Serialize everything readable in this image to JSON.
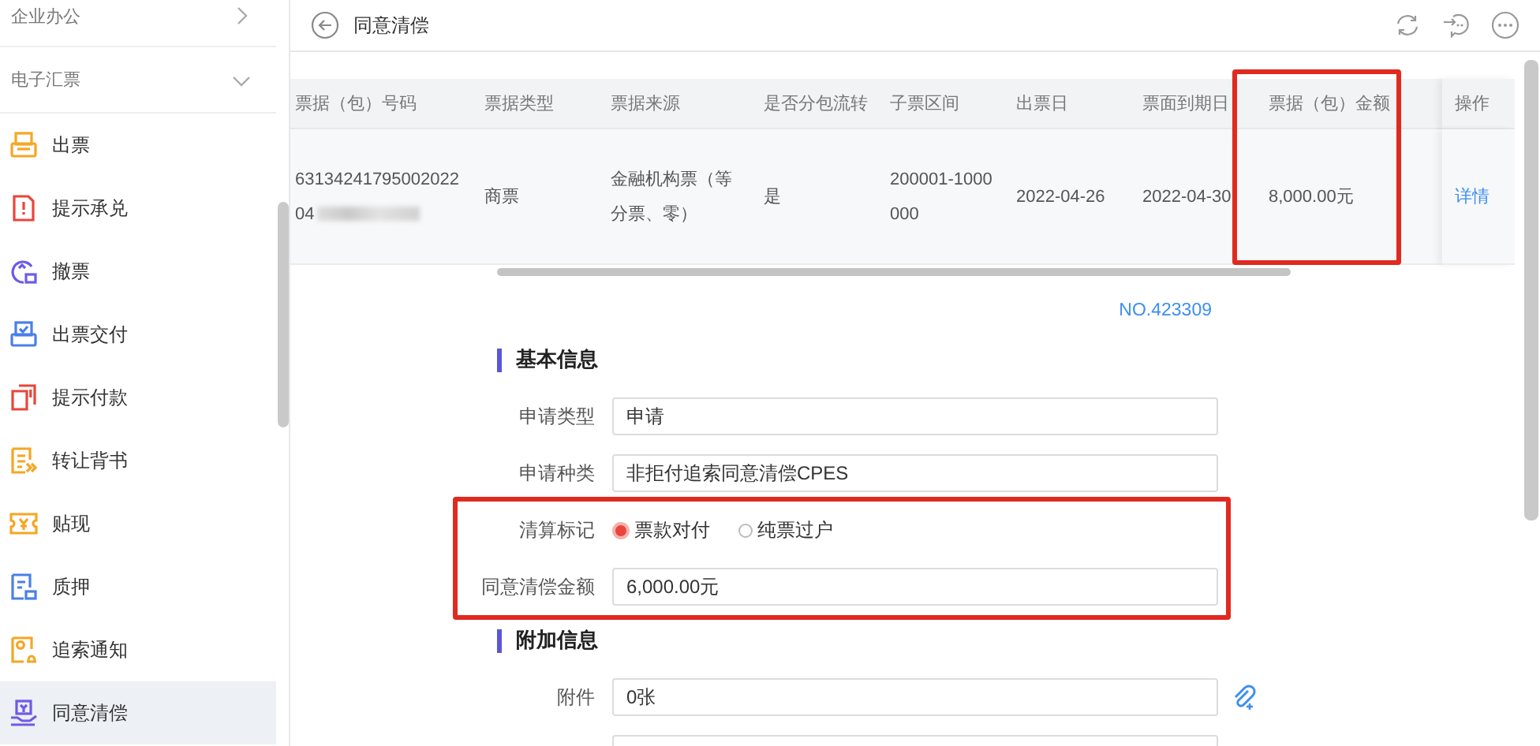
{
  "sidebar": {
    "groups": [
      {
        "label": "企业办公",
        "expanded": false
      },
      {
        "label": "电子汇票",
        "expanded": true
      }
    ],
    "items": [
      {
        "label": "出票",
        "selected": false
      },
      {
        "label": "提示承兑",
        "selected": false
      },
      {
        "label": "撤票",
        "selected": false
      },
      {
        "label": "出票交付",
        "selected": false
      },
      {
        "label": "提示付款",
        "selected": false
      },
      {
        "label": "转让背书",
        "selected": false
      },
      {
        "label": "贴现",
        "selected": false
      },
      {
        "label": "质押",
        "selected": false
      },
      {
        "label": "追索通知",
        "selected": false
      },
      {
        "label": "同意清偿",
        "selected": true
      }
    ]
  },
  "header": {
    "title": "同意清偿"
  },
  "table": {
    "columns": [
      {
        "label": "票据（包）号码",
        "highlighted": false
      },
      {
        "label": "票据类型",
        "highlighted": false
      },
      {
        "label": "票据来源",
        "highlighted": false
      },
      {
        "label": "是否分包流转",
        "highlighted": false
      },
      {
        "label": "子票区间",
        "highlighted": false
      },
      {
        "label": "出票日",
        "highlighted": false
      },
      {
        "label": "票面到期日",
        "highlighted": false
      },
      {
        "label": "票据（包）金额",
        "highlighted": true
      },
      {
        "label": "操作",
        "highlighted": false
      }
    ],
    "rows": [
      {
        "cells": [
          {
            "text": "6313424179500202204",
            "redacted": true
          },
          {
            "text": "商票"
          },
          {
            "text": "金融机构票（等分票、零）"
          },
          {
            "text": "是"
          },
          {
            "text": "200001-1000000"
          },
          {
            "text": "2022-04-26"
          },
          {
            "text": "2022-04-30"
          },
          {
            "text": "8,000.00元"
          },
          {
            "text": "详情",
            "kind": "link"
          }
        ]
      }
    ]
  },
  "form": {
    "number": "NO.423309",
    "sections": [
      {
        "title": "基本信息",
        "rows": [
          {
            "kind": "text",
            "label": "申请类型",
            "value": "申请"
          },
          {
            "kind": "text",
            "label": "申请种类",
            "value": "非拒付追索同意清偿CPES"
          },
          {
            "kind": "group",
            "highlighted": true,
            "rows": [
              {
                "kind": "radio",
                "label": "清算标记",
                "options": [
                  {
                    "label": "票款对付",
                    "selected": true
                  },
                  {
                    "label": "纯票过户",
                    "selected": false
                  }
                ]
              },
              {
                "kind": "text",
                "label": "同意清偿金额",
                "value": "6,000.00元"
              }
            ]
          }
        ]
      },
      {
        "title": "附加信息",
        "rows": [
          {
            "kind": "attachment",
            "label": "附件",
            "value": "0张"
          },
          {
            "kind": "text"
          }
        ]
      }
    ]
  }
}
